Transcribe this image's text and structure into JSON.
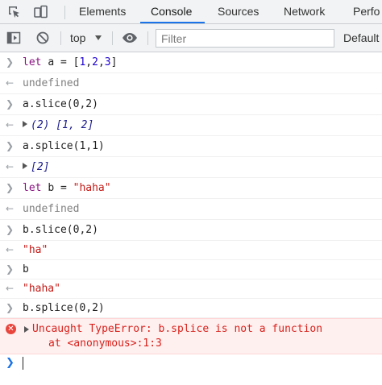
{
  "tabs": [
    {
      "label": "Elements"
    },
    {
      "label": "Console"
    },
    {
      "label": "Sources"
    },
    {
      "label": "Network"
    },
    {
      "label": "Perfo"
    }
  ],
  "toolbar": {
    "context": "top",
    "filter_placeholder": "Filter",
    "levels": "Default"
  },
  "console": {
    "entries": [
      {
        "input": "let a = [1,2,3]"
      },
      {
        "output": "undefined"
      },
      {
        "input": "a.slice(0,2)"
      },
      {
        "output": "(2) [1, 2]"
      },
      {
        "input": "a.splice(1,1)"
      },
      {
        "output": "[2]"
      },
      {
        "input": "let b = \"haha\""
      },
      {
        "output": "undefined"
      },
      {
        "input": "b.slice(0,2)"
      },
      {
        "output": "\"ha\""
      },
      {
        "input": "b"
      },
      {
        "output": "\"haha\""
      },
      {
        "input": "b.splice(0,2)"
      }
    ],
    "error": {
      "line1": "Uncaught TypeError: b.splice is not a function",
      "line2": "at <anonymous>:1:3"
    }
  },
  "colors": {
    "accent": "#1a73e8",
    "error": "#d8211b",
    "error_bg": "#fff0f0"
  }
}
